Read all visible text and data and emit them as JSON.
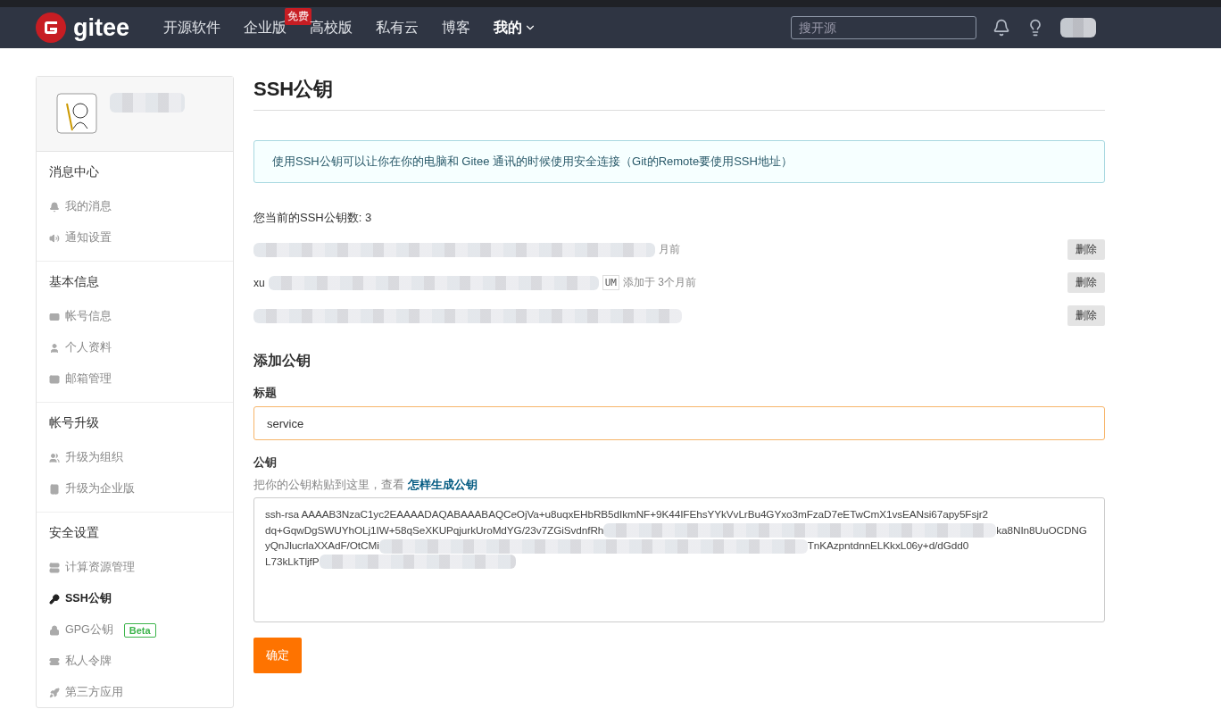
{
  "topbar": {
    "logo": "gitee",
    "nav": [
      {
        "label": "开源软件",
        "kind": "link"
      },
      {
        "label": "企业版",
        "kind": "link",
        "badge": "免费"
      },
      {
        "label": "高校版",
        "kind": "link"
      },
      {
        "label": "私有云",
        "kind": "link"
      },
      {
        "label": "博客",
        "kind": "link"
      },
      {
        "label": "我的",
        "kind": "menu"
      }
    ],
    "search": {
      "placeholder": "搜开源"
    }
  },
  "sidebar": {
    "sections": [
      {
        "title": "消息中心",
        "items": [
          {
            "label": "我的消息",
            "selected": false
          },
          {
            "label": "通知设置",
            "selected": false
          }
        ]
      },
      {
        "title": "基本信息",
        "items": [
          {
            "label": "帐号信息",
            "selected": false
          },
          {
            "label": "个人资料",
            "selected": false
          },
          {
            "label": "邮箱管理",
            "selected": false
          }
        ]
      },
      {
        "title": "帐号升级",
        "items": [
          {
            "label": "升级为组织",
            "selected": false
          },
          {
            "label": "升级为企业版",
            "selected": false
          }
        ]
      },
      {
        "title": "安全设置",
        "items": [
          {
            "label": "计算资源管理",
            "selected": false
          },
          {
            "label": "SSH公钥",
            "selected": true
          },
          {
            "label": "GPG公钥",
            "selected": false,
            "badge": "Beta"
          },
          {
            "label": "私人令牌",
            "selected": false
          },
          {
            "label": "第三方应用",
            "selected": false
          }
        ]
      }
    ]
  },
  "main": {
    "title": "SSH公钥",
    "info": "使用SSH公钥可以让你在你的电脑和 Gitee 通讯的时候使用安全连接（Git的Remote要使用SSH地址）",
    "count": "您当前的SSH公钥数: 3",
    "keys": [
      {
        "added": "月前",
        "action": "删除"
      },
      {
        "prefix": "xu",
        "fingerprint": "UM",
        "added": "添加于 3个月前",
        "action": "删除"
      },
      {
        "action": "删除"
      }
    ],
    "add_title": "添加公钥",
    "title_label": "标题",
    "title_value": "service",
    "key_label": "公钥",
    "key_hint": "把你的公钥粘贴到这里，查看 ",
    "key_hint_link": "怎样生成公钥",
    "key_lines": [
      {
        "kind": "plain",
        "text": "ssh-rsa AAAAB3NzaC1yc2EAAAADAQABAAABAQCeOjVa+u8uqxEHbRB5dIkmNF+9K44IFEhsYYkVvLrBu4GYxo3mFzaD7eETwCmX1vsEANsi67apy5Fsjr2"
      },
      {
        "kind": "redacted",
        "text": "dq+GqwDgSWUYhOLj1IW+58qSeXKUPqjurkUroMdYG/23v7ZGiSvdnfRh",
        "tail": "ka8NIn8UuOCDNG"
      },
      {
        "kind": "redacted",
        "text": "yQnJlucrlaXXAdF/OtCMi",
        "tail": "TnKAzpntdnnELKkxL06y+d/dGdd0"
      },
      {
        "kind": "redacted",
        "text": "L73kLkTljfP"
      }
    ],
    "submit": "确定"
  }
}
